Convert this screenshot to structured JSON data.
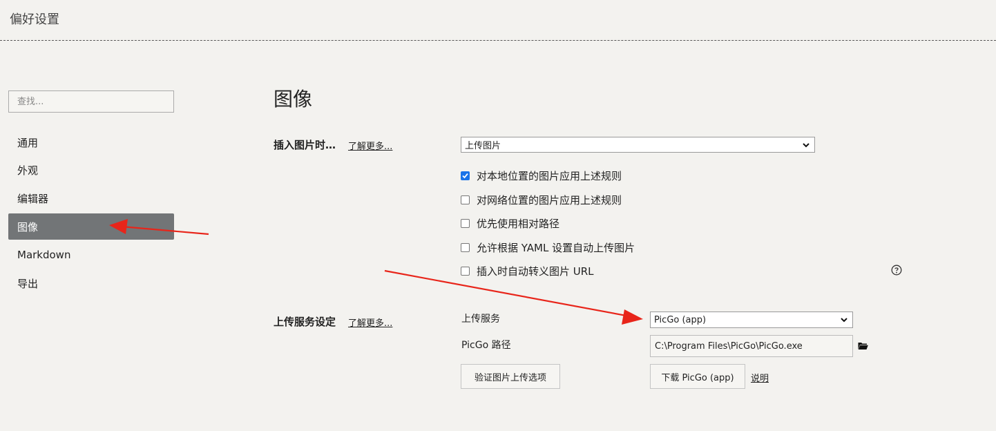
{
  "window": {
    "title": "偏好设置"
  },
  "sidebar": {
    "search_placeholder": "查找...",
    "items": [
      {
        "label": "通用"
      },
      {
        "label": "外观"
      },
      {
        "label": "编辑器"
      },
      {
        "label": "图像",
        "active": true
      },
      {
        "label": "Markdown"
      },
      {
        "label": "导出"
      }
    ]
  },
  "main": {
    "title": "图像",
    "insert_section": {
      "label": "插入图片时…",
      "learn_more": "了解更多...",
      "select_value": "上传图片",
      "checkboxes": [
        {
          "label": "对本地位置的图片应用上述规则",
          "checked": true
        },
        {
          "label": "对网络位置的图片应用上述规则",
          "checked": false
        },
        {
          "label": "优先使用相对路径",
          "checked": false
        },
        {
          "label": "允许根据 YAML 设置自动上传图片",
          "checked": false
        },
        {
          "label": "插入时自动转义图片 URL",
          "checked": false
        }
      ],
      "help_icon": "question-circle-icon"
    },
    "upload_section": {
      "label": "上传服务设定",
      "learn_more": "了解更多...",
      "service_label": "上传服务",
      "service_value": "PicGo (app)",
      "path_label": "PicGo 路径",
      "path_value": "C:\\Program Files\\PicGo\\PicGo.exe",
      "folder_icon": "folder-icon",
      "verify_button": "验证图片上传选项",
      "download_button": "下载 PicGo (app)",
      "doc_link": "说明"
    }
  },
  "colors": {
    "background": "#f3f2ef",
    "active_nav": "#727577",
    "checkbox_checked": "#1a73e8",
    "annotation_arrow": "#e8251a"
  }
}
